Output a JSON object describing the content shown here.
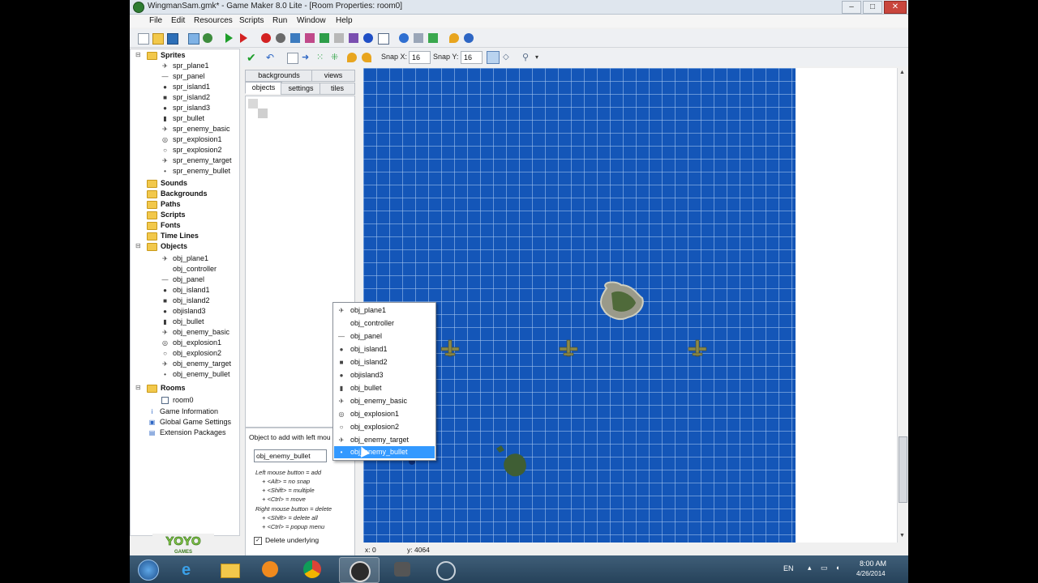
{
  "window": {
    "title": "WingmanSam.gmk* - Game Maker 8.0 Lite - [Room Properties: room0]",
    "buttons": {
      "minimize": "–",
      "maximize": "□",
      "close": "✕"
    }
  },
  "menubar": [
    "File",
    "Edit",
    "Resources",
    "Scripts",
    "Run",
    "Window",
    "Help"
  ],
  "tree": {
    "sprites_label": "Sprites",
    "sprites": [
      "spr_plane1",
      "spr_panel",
      "spr_island1",
      "spr_island2",
      "spr_island3",
      "spr_bullet",
      "spr_enemy_basic",
      "spr_explosion1",
      "spr_explosion2",
      "spr_enemy_target",
      "spr_enemy_bullet"
    ],
    "sounds_label": "Sounds",
    "backgrounds_label": "Backgrounds",
    "paths_label": "Paths",
    "scripts_label": "Scripts",
    "fonts_label": "Fonts",
    "timelines_label": "Time Lines",
    "objects_label": "Objects",
    "objects": [
      "obj_plane1",
      "obj_controller",
      "obj_panel",
      "obj_island1",
      "obj_island2",
      "objisland3",
      "obj_bullet",
      "obj_enemy_basic",
      "obj_explosion1",
      "obj_explosion2",
      "obj_enemy_target",
      "obj_enemy_bullet"
    ],
    "rooms_label": "Rooms",
    "rooms": [
      "room0"
    ],
    "extras": [
      "Game Information",
      "Global Game Settings",
      "Extension Packages"
    ]
  },
  "room_toolbar": {
    "snap_x_label": "Snap X:",
    "snap_x": "16",
    "snap_y_label": "Snap Y:",
    "snap_y": "16"
  },
  "tabs": {
    "top": [
      "backgrounds",
      "views"
    ],
    "bottom": [
      "objects",
      "settings",
      "tiles"
    ]
  },
  "add_panel": {
    "caption": "Object to add with left mou",
    "selected_object": "obj_enemy_bullet",
    "help_lines": [
      "Left mouse button = add",
      "+ <Alt> = no snap",
      "+ <Shift> = multiple",
      "+ <Ctrl> = move",
      "Right mouse button = delete",
      "+ <Shift> = delete all",
      "+ <Ctrl> = popup menu"
    ],
    "delete_underlying_label": "Delete underlying",
    "delete_underlying_checked": "✓"
  },
  "popup_menu": {
    "items": [
      "obj_plane1",
      "obj_controller",
      "obj_panel",
      "obj_island1",
      "obj_island2",
      "objisland3",
      "obj_bullet",
      "obj_enemy_basic",
      "obj_explosion1",
      "obj_explosion2",
      "obj_enemy_target",
      "obj_enemy_bullet"
    ],
    "selected_index": 11
  },
  "status": {
    "x": "x: 0",
    "y": "y: 4064"
  },
  "taskbar": {
    "lang": "EN",
    "time": "8:00 AM",
    "date": "4/26/2014"
  },
  "logo_text": "YOYO GAMES",
  "colors": {
    "room_blue": "#1456b8",
    "selection": "#3399ff",
    "folder": "#f2c84b"
  }
}
